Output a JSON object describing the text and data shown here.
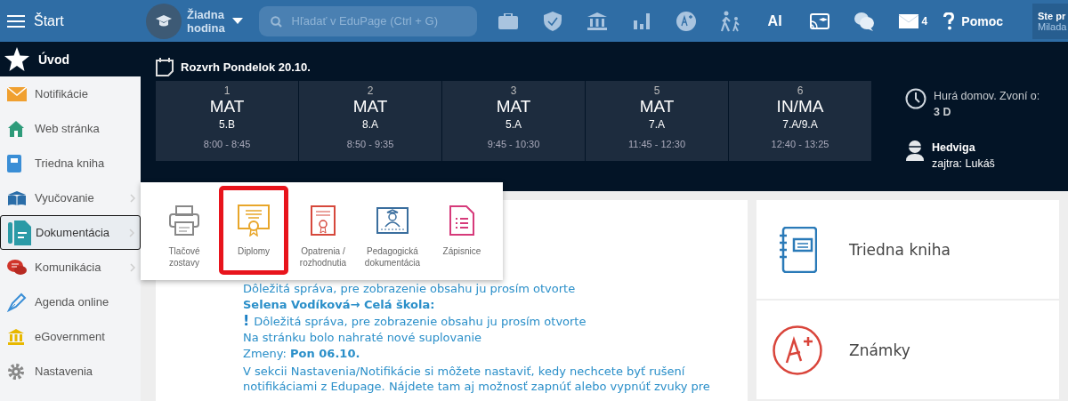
{
  "top_bar": {
    "menu_label": "Štart",
    "lesson_picker": "Žiadna\nhodina",
    "search": {
      "placeholder": "Hľadať v EduPage (Ctrl + G)"
    },
    "ai_label": "AI",
    "mail_count": "4",
    "help_label": "Pomoc",
    "user": {
      "line_1": "Ste pr",
      "line_2": "Milada"
    }
  },
  "sidebar": {
    "header": "Úvod",
    "items": [
      {
        "label": "Notifikácie",
        "selected": false,
        "has_submenu": false
      },
      {
        "label": "Web stránka",
        "selected": false,
        "has_submenu": false
      },
      {
        "label": "Triedna kniha",
        "selected": false,
        "has_submenu": false
      },
      {
        "label": "Vyučovanie",
        "selected": false,
        "has_submenu": true
      },
      {
        "label": "Dokumentácia",
        "selected": true,
        "has_submenu": true
      },
      {
        "label": "Komunikácia",
        "selected": false,
        "has_submenu": true
      },
      {
        "label": "Agenda online",
        "selected": false,
        "has_submenu": false
      },
      {
        "label": "eGovernment",
        "selected": false,
        "has_submenu": false
      },
      {
        "label": "Nastavenia",
        "selected": false,
        "has_submenu": false
      }
    ]
  },
  "timetable": {
    "title": "Rozvrh Pondelok 20.10.",
    "lessons": [
      {
        "period": "1",
        "subject": "MAT",
        "class": "5.B",
        "time": "8:00 - 8:45"
      },
      {
        "period": "2",
        "subject": "MAT",
        "class": "8.A",
        "time": "8:50 - 9:35"
      },
      {
        "period": "3",
        "subject": "MAT",
        "class": "5.A",
        "time": "9:45 - 10:30"
      },
      {
        "period": "5",
        "subject": "MAT",
        "class": "7.A",
        "time": "11:45 - 12:30"
      },
      {
        "period": "6",
        "subject": "IN/MA",
        "class": "7.A/9.A",
        "time": "12:40 - 13:25"
      }
    ]
  },
  "bell": {
    "text": "Hurá domov. Zvoní o:",
    "value": "3 D"
  },
  "duty": {
    "name": "Hedviga",
    "next": "zajtra: Lukáš"
  },
  "submenu": {
    "items": [
      {
        "label": "Tlačové\nzostavy",
        "selected": false
      },
      {
        "label": "Diplomy",
        "selected": true
      },
      {
        "label": "Opatrenia /\nrozhodnutia",
        "selected": false
      },
      {
        "label": "Pedagogická\ndokumentácia",
        "selected": false
      },
      {
        "label": "Zápisnice",
        "selected": false
      }
    ]
  },
  "feed": [
    {
      "kind": "text",
      "text": "Dôležitá správa, pre zobrazenie obsahu ju prosím otvorte"
    },
    {
      "kind": "sender",
      "text": "Selena Vodíková→ Celá škola:"
    },
    {
      "kind": "important",
      "mark": "!",
      "text": "Dôležitá správa, pre zobrazenie obsahu ju prosím otvorte"
    },
    {
      "kind": "text",
      "text": "Na stránku bolo nahraté nové suplovanie"
    },
    {
      "kind": "text",
      "text": "Zmeny: **Pon 06.10.**"
    },
    {
      "kind": "paragraph",
      "text": "V sekcii Nastavenia/Notifikácie si môžete nastaviť, kedy nechcete byť rušení notifikáciami z Edupage. Nájdete tam aj možnosť zapnúť alebo vypnúť zvuky pre"
    }
  ],
  "shortcuts": [
    {
      "label": "Triedna kniha"
    },
    {
      "label": "Známky"
    }
  ]
}
